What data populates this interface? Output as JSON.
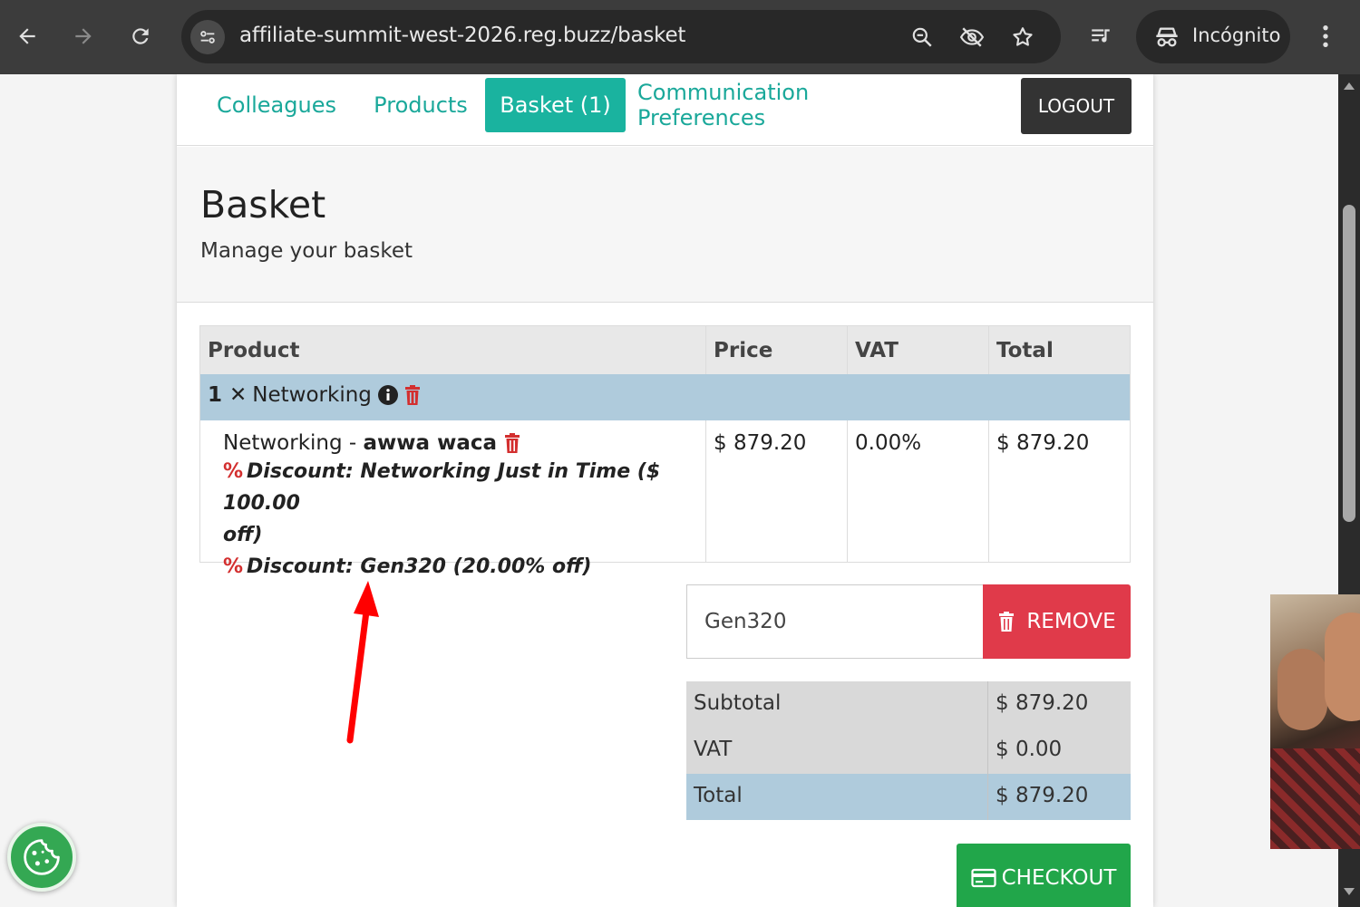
{
  "browser": {
    "url": "affiliate-summit-west-2026.reg.buzz/basket",
    "incognito_label": "Incógnito"
  },
  "nav": {
    "tabs": [
      {
        "label": "Colleagues"
      },
      {
        "label": "Products"
      },
      {
        "label": "Basket (1)"
      },
      {
        "label": "Communication Preferences"
      }
    ],
    "logout_label": "LOGOUT"
  },
  "header": {
    "title": "Basket",
    "subtitle": "Manage your basket"
  },
  "table": {
    "columns": [
      "Product",
      "Price",
      "VAT",
      "Total"
    ],
    "group": {
      "qty": "1",
      "times": "✕",
      "name": "Networking"
    },
    "row": {
      "product_prefix": "Networking - ",
      "attendee": "awwa waca",
      "discount1_line1": "Discount: Networking Just in Time ($ 100.00",
      "discount1_line2": "off)",
      "discount2": "Discount: Gen320 (20.00% off)",
      "price": "$ 879.20",
      "vat": "0.00%",
      "total": "$ 879.20"
    }
  },
  "coupon": {
    "value": "Gen320",
    "remove_label": "REMOVE"
  },
  "totals": {
    "subtotal_label": "Subtotal",
    "subtotal_value": "$ 879.20",
    "vat_label": "VAT",
    "vat_value": "$ 0.00",
    "total_label": "Total",
    "total_value": "$ 879.20"
  },
  "checkout_label": "CHECKOUT",
  "colors": {
    "accent": "#1ab39f",
    "danger": "#e03a4a",
    "success": "#21a64a",
    "row_highlight": "#afcbdc",
    "annotation_arrow": "#ff0000"
  }
}
